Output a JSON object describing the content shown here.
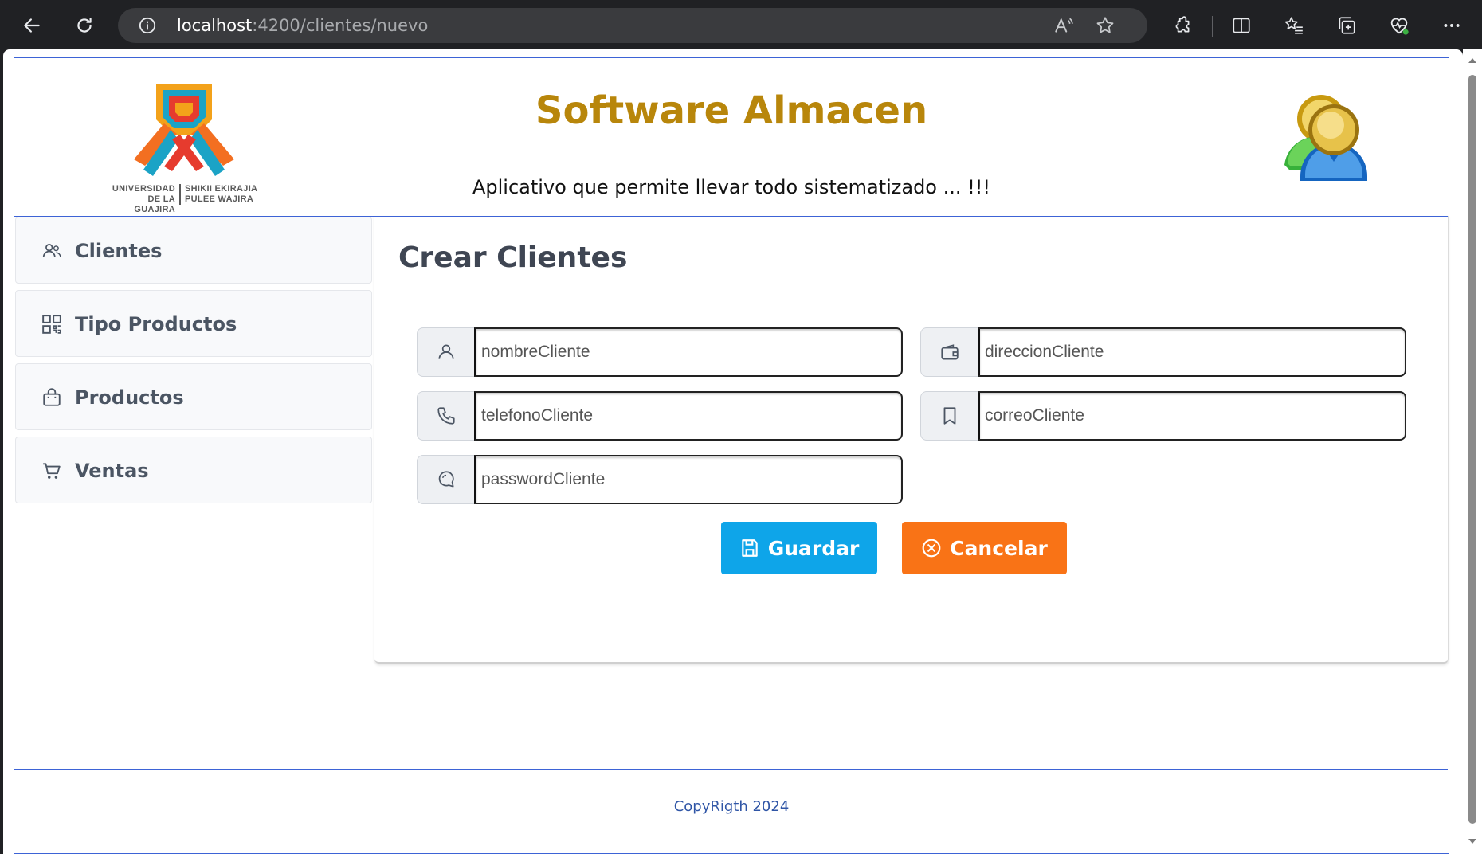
{
  "browser": {
    "url_host": "localhost",
    "url_path": ":4200/clientes/nuevo"
  },
  "header": {
    "title": "Software Almacen",
    "subtitle": "Aplicativo que permite llevar todo sistematizado ... !!!",
    "logo_text_left_1": "UNIVERSIDAD",
    "logo_text_left_2": "DE LA GUAJIRA",
    "logo_text_right_1": "SHIKII EKIRAJIA",
    "logo_text_right_2": "PULEE  WAJIRA"
  },
  "sidebar": {
    "items": [
      {
        "label": "Clientes",
        "icon": "users-icon"
      },
      {
        "label": "Tipo Productos",
        "icon": "qr-grid-icon"
      },
      {
        "label": "Productos",
        "icon": "shopping-bag-icon"
      },
      {
        "label": "Ventas",
        "icon": "cart-icon"
      }
    ]
  },
  "form": {
    "title": "Crear Clientes",
    "fields": {
      "nombre": {
        "placeholder": "nombreCliente",
        "icon": "user-icon"
      },
      "direccion": {
        "placeholder": "direccionCliente",
        "icon": "wallet-icon"
      },
      "telefono": {
        "placeholder": "telefonoCliente",
        "icon": "phone-icon"
      },
      "correo": {
        "placeholder": "correoCliente",
        "icon": "bookmark-icon"
      },
      "password": {
        "placeholder": "passwordCliente",
        "icon": "chat-icon"
      }
    },
    "save_label": "Guardar",
    "cancel_label": "Cancelar",
    "save_color": "#0ea5e9",
    "cancel_color": "#f97316"
  },
  "footer": {
    "copyright": "CopyRigth 2024"
  },
  "colors": {
    "title": "#b8860b",
    "frame_border": "#3d63d6"
  }
}
